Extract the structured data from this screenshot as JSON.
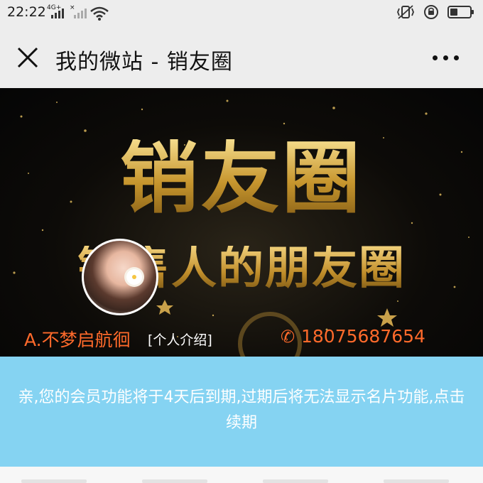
{
  "status_bar": {
    "time": "22:22",
    "net_1": "4G+",
    "net_2": "×"
  },
  "navbar": {
    "title": "我的微站 - 销友圈"
  },
  "banner": {
    "title": "销友圈",
    "subtitle": "销售人的朋友圈"
  },
  "profile": {
    "name": "A.不梦启航徊",
    "intro_link": "[个人介绍]",
    "phone": "18075687654"
  },
  "notice": {
    "text": "亲,您的会员功能将于4天后到期,过期后将无法显示名片功能,点击续期"
  },
  "colors": {
    "accent_orange": "#ff6a2b",
    "notice_bg": "#85d3f2",
    "gold": "#d9b24f"
  },
  "icons": {
    "close": "close-icon",
    "more": "more-icon",
    "phone": "phone-icon",
    "wifi": "wifi-icon",
    "battery": "battery-icon"
  }
}
